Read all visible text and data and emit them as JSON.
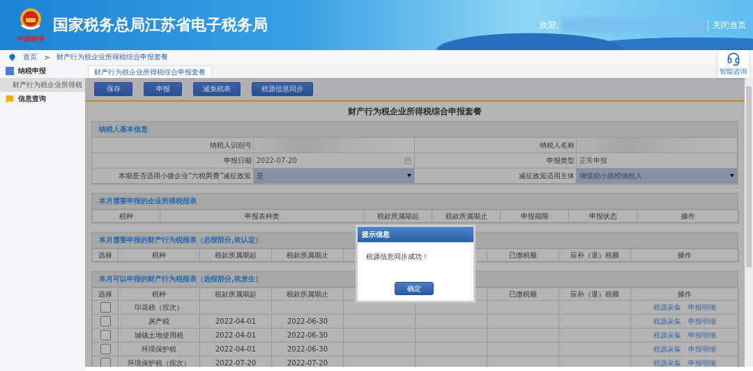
{
  "header": {
    "title": "国家税务总局江苏省电子税务局",
    "logo_text": "中国税务",
    "welcome": "欢迎,",
    "close_link": "关闭当页"
  },
  "breadcrumb": {
    "home": "首页",
    "separator": ">",
    "current": "财产行为税企业所得税综合申报套餐"
  },
  "help_widget": {
    "label": "智能咨询"
  },
  "sidebar": {
    "items": [
      {
        "label": "纳税申报",
        "kind": "declare",
        "children": [
          {
            "label": "财产行为税企业所得税",
            "selected": true
          }
        ]
      },
      {
        "label": "信息查询",
        "kind": "query"
      }
    ]
  },
  "tabs": [
    {
      "label": "财产行为税企业所得税综合申报套餐",
      "selected": true
    }
  ],
  "toolbar": [
    "保存",
    "申报",
    "减免税表",
    "税源信息同步"
  ],
  "form_title": "财产行为税企业所得税综合申报套餐",
  "basic_info": {
    "title": "纳税人基本信息",
    "fields": [
      {
        "label": "纳税人识别号",
        "kind": "redacted"
      },
      {
        "label": "纳税人名称",
        "kind": "redacted"
      },
      {
        "label": "申报日期",
        "kind": "date",
        "value": "2022-07-20"
      },
      {
        "label": "申报类型",
        "kind": "text",
        "value": "正常申报"
      },
      {
        "label": "本期是否适用小微企业“六税两费”减征政策",
        "kind": "select",
        "value": "是"
      },
      {
        "label": "减征政策适用主体",
        "kind": "select",
        "value": "增值税小规模纳税人"
      }
    ]
  },
  "tables": [
    {
      "kind": "income",
      "title": "本月需要申报的企业所得税报表",
      "columns": [
        "税种",
        "申报表种类",
        "税款所属期起",
        "税款所属期止",
        "申报期限",
        "申报状态",
        "操作"
      ]
    },
    {
      "kind": "property",
      "title": "本月需要申报的财产行为税报表（必报部分,依认定）",
      "columns": [
        "选择",
        "税种",
        "税款所属期起",
        "税款所属期止"
      ],
      "columns_right": [
        "已缴税额",
        "应补（退）税额",
        "操作"
      ]
    },
    {
      "kind": "property",
      "title": "本月可以申报的财产行为税报表（选报部分,依发生）",
      "columns": [
        "选择",
        "税种",
        "税款所属期起",
        "税款所属期止"
      ],
      "columns_right": [
        "已缴税额",
        "应补（退）税额",
        "操作"
      ],
      "rows": [
        {
          "checked": false,
          "tax": "印花税（按次）",
          "actions": [
            "税源采集",
            "申报明细"
          ]
        },
        {
          "checked": false,
          "tax": "房产税",
          "period_start": "2022-04-01",
          "period_end": "2022-06-30",
          "actions": [
            "税源采集",
            "申报明细"
          ]
        },
        {
          "checked": false,
          "tax": "城镇土地使用税",
          "period_start": "2022-04-01",
          "period_end": "2022-06-30",
          "actions": [
            "税源采集",
            "申报明细"
          ]
        },
        {
          "checked": false,
          "tax": "环境保护税",
          "period_start": "2022-04-01",
          "period_end": "2022-06-30",
          "actions": [
            "税源采集",
            "申报明细"
          ]
        },
        {
          "checked": false,
          "tax": "环境保护税（按次）",
          "period_start": "2022-07-20",
          "period_end": "2022-07-20",
          "actions": [
            "税源采集",
            "申报明细"
          ]
        }
      ]
    }
  ],
  "dialog": {
    "title": "提示信息",
    "message": "税源信息同步成功！",
    "button": "确定"
  }
}
